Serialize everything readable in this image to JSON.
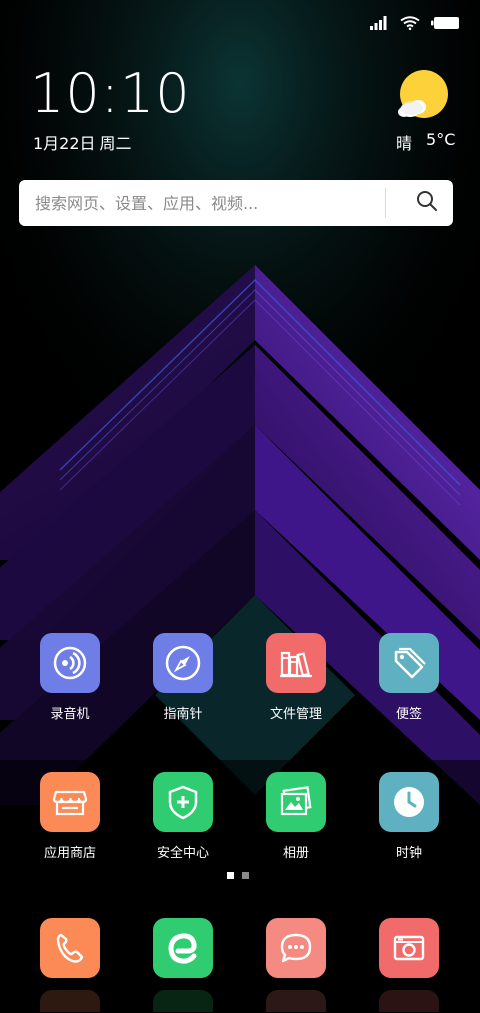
{
  "status_bar": {
    "icons": [
      "signal-icon",
      "wifi-icon",
      "battery-icon"
    ]
  },
  "clock": {
    "time": "10:10",
    "date": "1月22日",
    "weekday": "周二"
  },
  "weather": {
    "icon": "sun-cloud-icon",
    "condition": "晴",
    "temperature": "5°C"
  },
  "search": {
    "placeholder": "搜索网页、设置、应用、视频..."
  },
  "apps": [
    {
      "label": "录音机",
      "icon": "recorder-icon",
      "color": "#6f7ee6"
    },
    {
      "label": "指南针",
      "icon": "compass-icon",
      "color": "#6f7ee6"
    },
    {
      "label": "文件管理",
      "icon": "file-manager-icon",
      "color": "#f26b6b"
    },
    {
      "label": "便签",
      "icon": "tag-icon",
      "color": "#5fb1c1"
    },
    {
      "label": "应用商店",
      "icon": "store-icon",
      "color": "#fb8a57"
    },
    {
      "label": "安全中心",
      "icon": "shield-plus-icon",
      "color": "#2fcc71"
    },
    {
      "label": "相册",
      "icon": "gallery-icon",
      "color": "#2fcc71"
    },
    {
      "label": "时钟",
      "icon": "clock-icon",
      "color": "#5fb1c1"
    }
  ],
  "page_indicator": {
    "current": 1,
    "total": 2,
    "active_color": "#ffffff",
    "inactive_color": "#8a8a8a"
  },
  "dock": [
    {
      "icon": "phone-icon",
      "color": "#fb8a57"
    },
    {
      "icon": "browser-icon",
      "color": "#2fcc71"
    },
    {
      "icon": "messages-icon",
      "color": "#f48a82"
    },
    {
      "icon": "camera-icon",
      "color": "#f26b6b"
    }
  ]
}
